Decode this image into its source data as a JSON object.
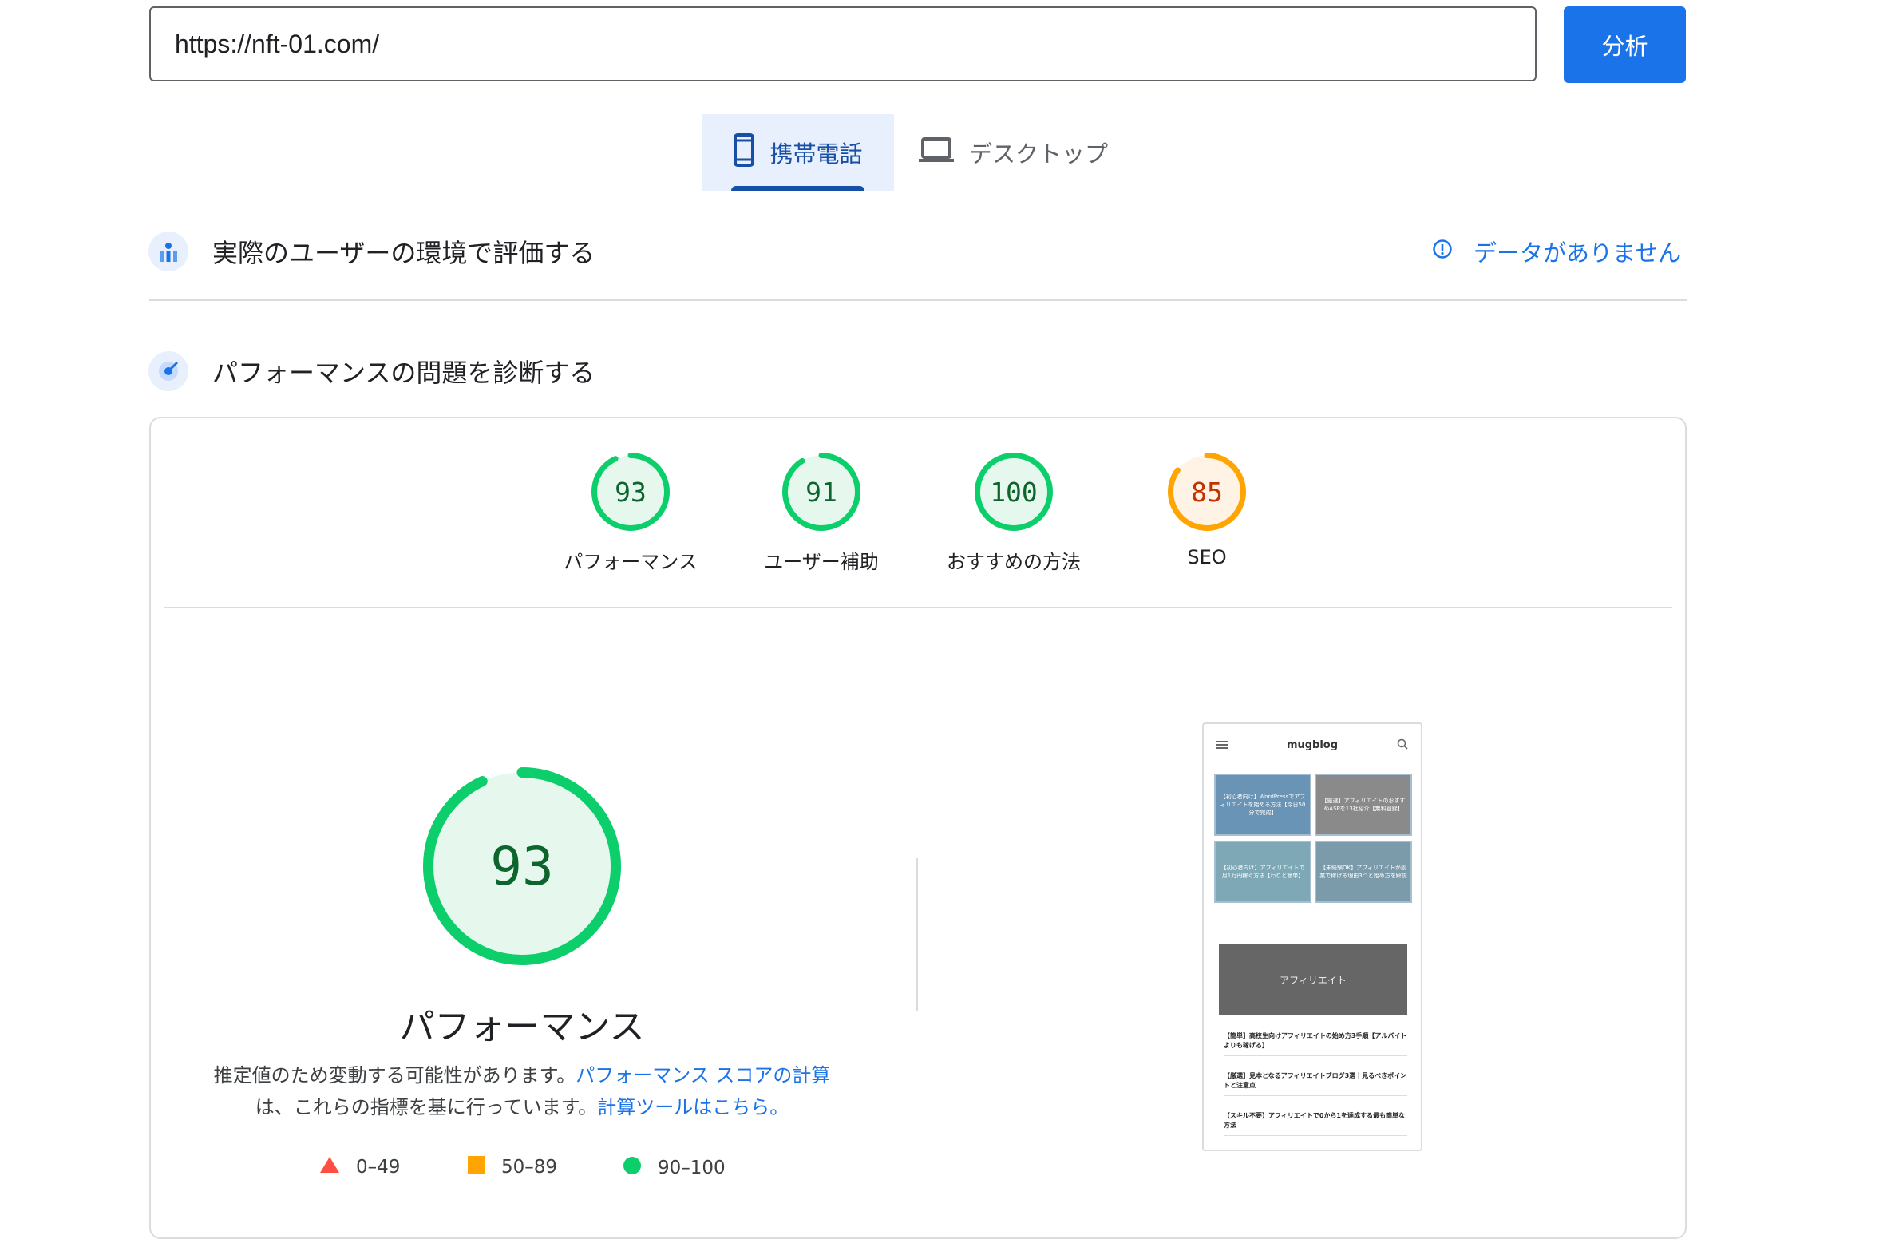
{
  "url_bar": {
    "value": "https://nft-01.com/",
    "analyze_label": "分析"
  },
  "device_tabs": {
    "mobile": "携帯電話",
    "desktop": "デスクトップ"
  },
  "field_section": {
    "title": "実際のユーザーの環境で評価する",
    "no_data": "データがありません"
  },
  "lab_section": {
    "title": "パフォーマンスの問題を診断する"
  },
  "colors": {
    "good": "#0cce6b",
    "average": "#ffa400",
    "poor": "#ff4e42",
    "accent": "#1a73e8"
  },
  "scores": [
    {
      "value": "93",
      "fraction": 0.93,
      "label": "パフォーマンス",
      "rating": "good"
    },
    {
      "value": "91",
      "fraction": 0.91,
      "label": "ユーザー補助",
      "rating": "good"
    },
    {
      "value": "100",
      "fraction": 1.0,
      "label": "おすすめの方法",
      "rating": "good"
    },
    {
      "value": "85",
      "fraction": 0.85,
      "label": "SEO",
      "rating": "average"
    }
  ],
  "performance": {
    "score": "93",
    "fraction": 0.93,
    "title": "パフォーマンス",
    "desc_text1": "推定値のため変動する可能性があります。",
    "desc_link1": "パフォーマンス スコアの計算",
    "desc_text2": "は、これらの指標を基に行っています。",
    "desc_link2": "計算ツールはこちら。"
  },
  "legend": {
    "poor": "0–49",
    "average": "50–89",
    "good": "90–100"
  },
  "preview": {
    "site_name": "mugblog",
    "thumbs": [
      "【初心者向け】WordPressでアフィリエイトを始める方法【今日50分で完成】",
      "【厳選】アフィリエイトのおすすめASPを13社紹介【無料登録】",
      "【初心者向け】アフィリエイトで月1万円稼ぐ方法【わりと簡単】",
      "【未経験OK】アフィリエイトが副業で稼げる理由3つと始め方を解説"
    ],
    "hero_label": "アフィリエイト",
    "posts": [
      "【簡単】高校生向けアフィリエイトの始め方3手順【アルバイトよりも稼げる】",
      "【厳選】見本となるアフィリエイトブログ3選｜見るべきポイントと注意点",
      "【スキル不要】アフィリエイトで0から1を達成する最も簡単な方法"
    ]
  }
}
